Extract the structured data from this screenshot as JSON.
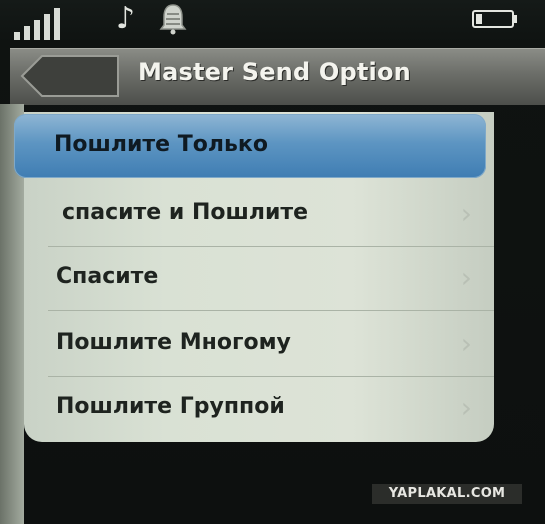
{
  "status_bar": {
    "icons": [
      "signal-icon",
      "music-note-icon",
      "bell-icon",
      "battery-icon"
    ]
  },
  "header": {
    "title": "Master Send Option",
    "back_icon": "back-arrow-icon"
  },
  "menu": {
    "selected_index": 0,
    "items": [
      {
        "label": "Пошлите Только"
      },
      {
        "label": "спасите и Пошлите"
      },
      {
        "label": "Спасите"
      },
      {
        "label": "Пошлите Многому"
      },
      {
        "label": "Пошлите Группой"
      }
    ]
  },
  "watermark": {
    "text": "YAPLAKAL.COM"
  },
  "colors": {
    "selection": "#5d95c2",
    "list_background": "#dde3d7",
    "title_bar": "#6b6d68"
  }
}
